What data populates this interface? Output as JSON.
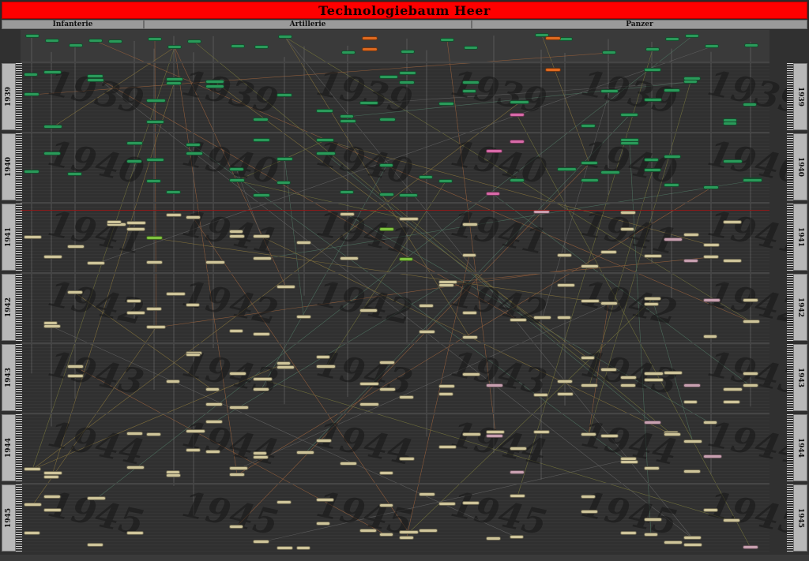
{
  "title": "Technologiebaum Heer",
  "branches": {
    "infantry": "Infanterie",
    "artillery": "Artillerie",
    "armor": "Panzer"
  },
  "years": [
    "1939",
    "1940",
    "1941",
    "1942",
    "1943",
    "1944",
    "1945"
  ],
  "colors": {
    "title_bg": "#ff0000",
    "node_1939_1940": "#2a9a5a",
    "node_later": "#cfc59a",
    "node_special": "#d86aa8",
    "node_highlight": "#e06a20"
  }
}
